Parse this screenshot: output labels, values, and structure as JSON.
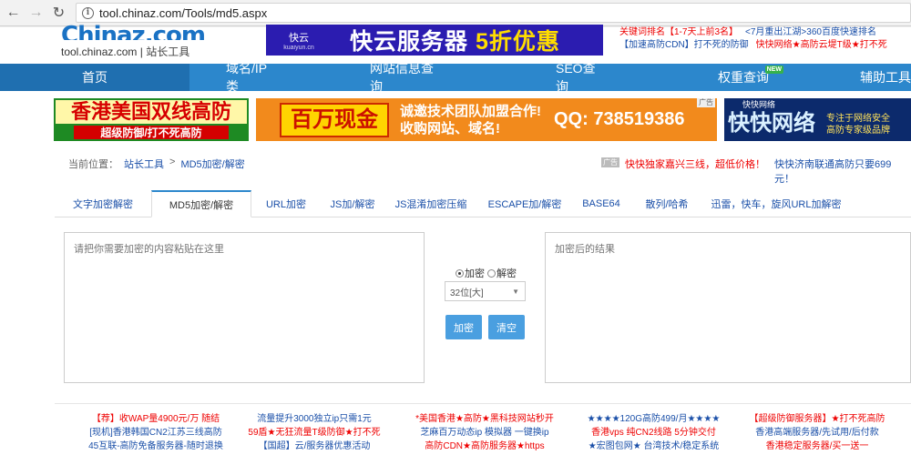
{
  "browser": {
    "url": "tool.chinaz.com/Tools/md5.aspx",
    "back_icon": "arrow-left-icon",
    "forward_icon": "arrow-right-icon",
    "reload_icon": "reload-icon",
    "info_icon": "info-icon"
  },
  "header": {
    "logo_text": "Chinaz.com",
    "logo_domain": "tool.chinaz.com",
    "logo_sep": "|",
    "logo_name": "站长工具",
    "banner_brand": "快云",
    "banner_brand_sub": "kuaiyun.cn",
    "banner_text": "快云服务器",
    "banner_highlight": "5折优惠",
    "toplinks": [
      {
        "text": "关键词排名【1-7天上前3名】",
        "color": "red"
      },
      {
        "text": "<7月重出江湖>360百度快速排名",
        "color": "blue"
      },
      {
        "text": "【加速高防CDN】打不死的防御",
        "color": "blue"
      },
      {
        "text": "快快网络★高防云堤T级★打不死",
        "color": "red"
      }
    ]
  },
  "nav": {
    "items": [
      {
        "label": "首页",
        "active": true
      },
      {
        "label": "域名/IP类",
        "active": false
      },
      {
        "label": "网站信息查询",
        "active": false
      },
      {
        "label": "SEO查询",
        "active": false
      },
      {
        "label": "权重查询",
        "active": false,
        "badge": "NEW"
      },
      {
        "label": "辅助工具",
        "active": false
      }
    ]
  },
  "ads": {
    "ad1_title": "香港美国双线高防",
    "ad1_sub": "超级防御/打不死高防",
    "ad2_box": "百万现金",
    "ad2_line1": "诚邀技术团队加盟合作!",
    "ad2_line2": "收购网站、域名!",
    "ad2_qq": "QQ: 738519386",
    "ad2_tag": "广告",
    "ad3_top": "快快网络",
    "ad3_big": "快快网络",
    "ad3_side1": "专注于网络安全",
    "ad3_side2": "高防专家级品牌"
  },
  "breadcrumb": {
    "prefix": "当前位置：",
    "parent": "站长工具",
    "sep": ">",
    "current": "MD5加密/解密"
  },
  "promos": {
    "tag": "广告",
    "left": "快快独家嘉兴三线，超低价格！",
    "right": "快快济南联通高防只要699元！"
  },
  "tabs": [
    {
      "label": "文字加密解密",
      "active": false
    },
    {
      "label": "MD5加密/解密",
      "active": true
    },
    {
      "label": "URL加密",
      "active": false
    },
    {
      "label": "JS加/解密",
      "active": false
    },
    {
      "label": "JS混淆加密压缩",
      "active": false
    },
    {
      "label": "ESCAPE加/解密",
      "active": false
    },
    {
      "label": "BASE64",
      "active": false
    },
    {
      "label": "散列/哈希",
      "active": false
    },
    {
      "label": "迅雷，快车，旋风URL加解密",
      "active": false
    }
  ],
  "tool": {
    "input_placeholder": "请把你需要加密的内容粘贴在这里",
    "output_placeholder": "加密后的结果",
    "radio_encrypt": "加密",
    "radio_decrypt": "解密",
    "radio_selected": "encrypt",
    "bits_selected": "32位[大]",
    "encrypt_button": "加密",
    "clear_button": "清空"
  },
  "bottom_links": [
    [
      "【荐】收WAP量4900元/万 随结",
      "[现机]香港韩国CN2江苏三线高防",
      "45互联-高防免备服务器-随时退换"
    ],
    [
      "流量提升3000独立ip只需1元",
      "59盾★无狂流量T级防御★打不死",
      "【国超】云/服务器优惠活动"
    ],
    [
      "*美国香港★高防★黑科技网站秒开",
      "芝麻百万动态ip 模拟器 一键换ip",
      "高防CDN★高防服务器★https"
    ],
    [
      "★★★★120G高防499/月★★★★",
      "香港vps 纯CN2线路 5分钟交付",
      "★宏图包网★ 台湾技术/稳定系统"
    ],
    [
      "【超级防御服务器】★打不死高防",
      "香港高端服务器/先试用/后付款",
      "香港稳定服务器/买一送一"
    ]
  ]
}
